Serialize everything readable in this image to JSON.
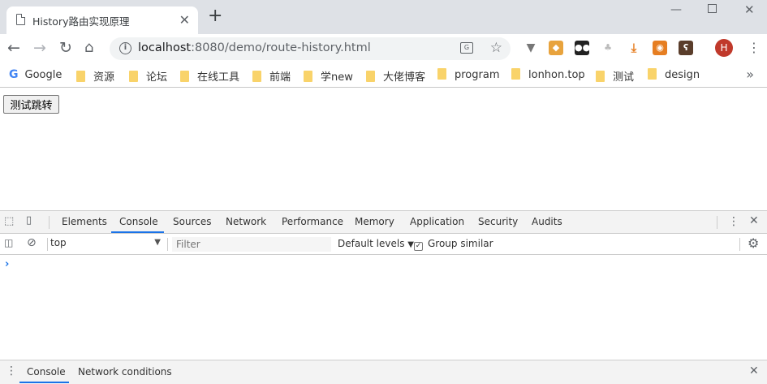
{
  "browser": {
    "tab_title": "History路由实现原理",
    "url_host": "localhost",
    "url_rest": ":8080/demo/route-history.html",
    "profile_initial": "H"
  },
  "bookmarks": [
    {
      "label": "Google",
      "icon": "google-icon"
    },
    {
      "label": "资源",
      "icon": "folder-icon"
    },
    {
      "label": "论坛",
      "icon": "folder-icon"
    },
    {
      "label": "在线工具",
      "icon": "folder-icon"
    },
    {
      "label": "前端",
      "icon": "folder-icon"
    },
    {
      "label": "学new",
      "icon": "folder-icon"
    },
    {
      "label": "大佬博客",
      "icon": "folder-icon"
    },
    {
      "label": "program",
      "icon": "folder-icon"
    },
    {
      "label": "lonhon.top",
      "icon": "folder-icon"
    },
    {
      "label": "测试",
      "icon": "folder-icon"
    },
    {
      "label": "design",
      "icon": "folder-icon"
    }
  ],
  "page": {
    "button_label": "测试跳转"
  },
  "devtools": {
    "tabs": [
      "Elements",
      "Console",
      "Sources",
      "Network",
      "Performance",
      "Memory",
      "Application",
      "Security",
      "Audits"
    ],
    "active_tab": "Console",
    "context": "top",
    "filter_placeholder": "Filter",
    "levels": "Default levels",
    "group_similar": "Group similar",
    "group_similar_checked": true,
    "drawer_tabs": [
      "Console",
      "Network conditions"
    ]
  },
  "colors": {
    "accent": "#1a73e8",
    "tab_strip": "#dee1e6",
    "folder": "#f9d36a"
  }
}
